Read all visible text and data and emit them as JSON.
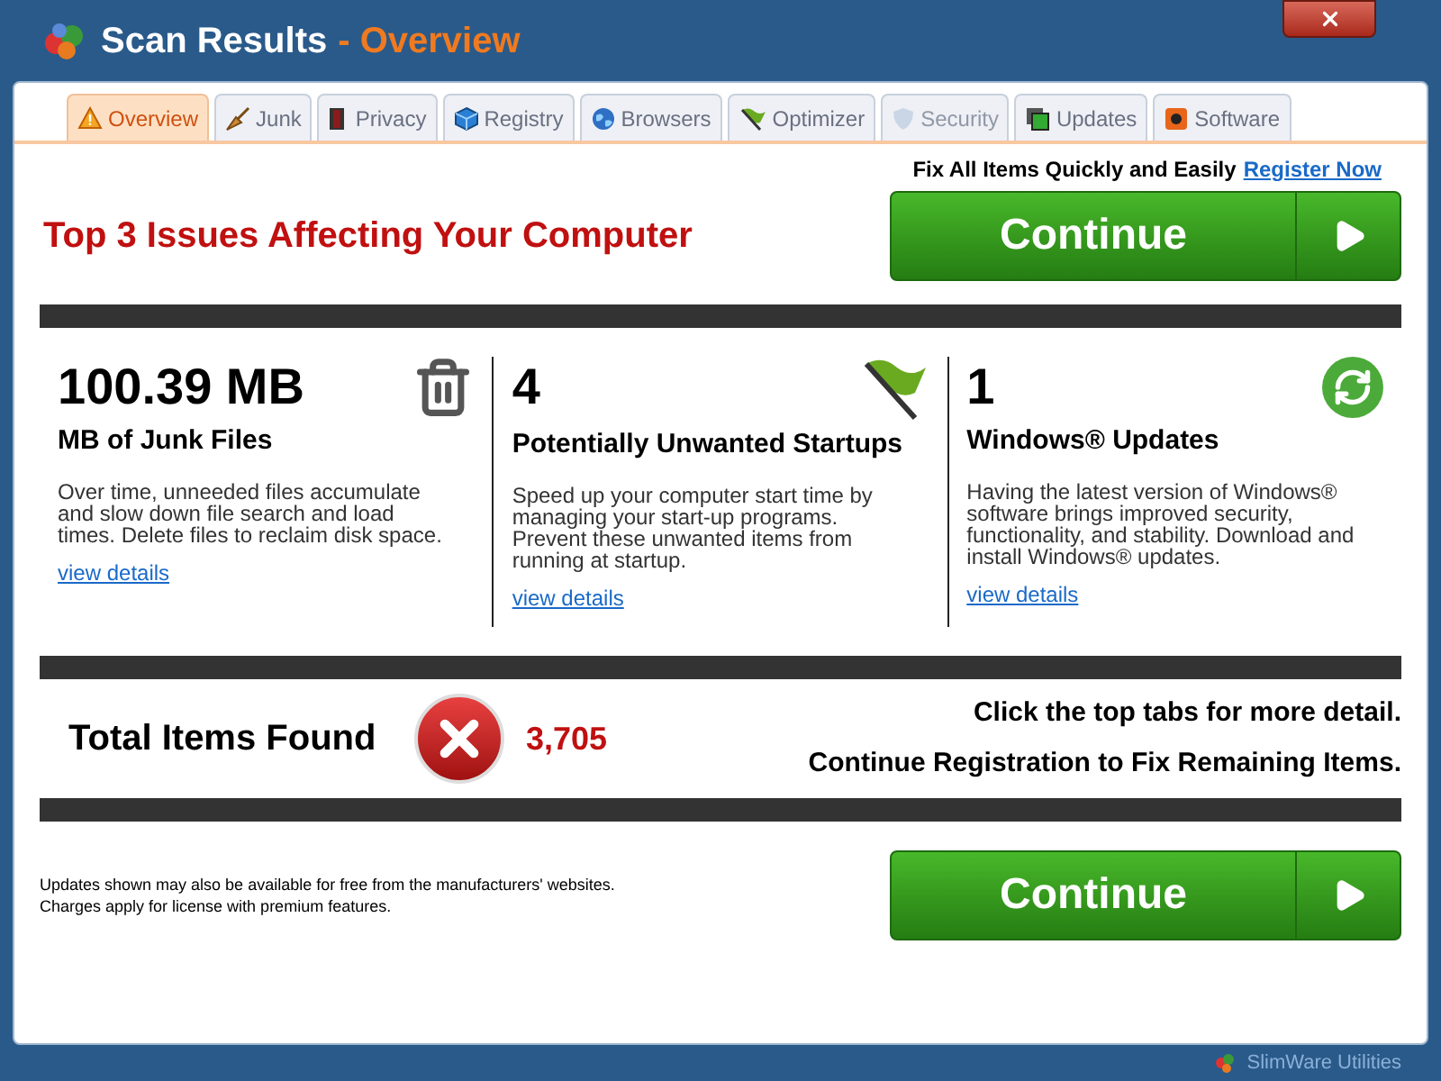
{
  "window": {
    "title": "Scan Results",
    "subtitle": "- Overview"
  },
  "tabs": [
    {
      "label": "Overview",
      "kind": "warning",
      "selected": true,
      "disabled": false
    },
    {
      "label": "Junk",
      "kind": "broom",
      "selected": false,
      "disabled": false
    },
    {
      "label": "Privacy",
      "kind": "door",
      "selected": false,
      "disabled": false
    },
    {
      "label": "Registry",
      "kind": "cube",
      "selected": false,
      "disabled": false
    },
    {
      "label": "Browsers",
      "kind": "globe",
      "selected": false,
      "disabled": false
    },
    {
      "label": "Optimizer",
      "kind": "flag",
      "selected": false,
      "disabled": false
    },
    {
      "label": "Security",
      "kind": "shield",
      "selected": false,
      "disabled": true
    },
    {
      "label": "Updates",
      "kind": "windows",
      "selected": false,
      "disabled": false
    },
    {
      "label": "Software",
      "kind": "box",
      "selected": false,
      "disabled": false
    }
  ],
  "promo": {
    "text": "Fix All Items Quickly and Easily",
    "link": "Register Now"
  },
  "headline": "Top 3 Issues Affecting Your Computer",
  "continue_top": "Continue",
  "issues": [
    {
      "kind": "trash",
      "value": "100.39 MB",
      "title": "MB of Junk Files",
      "description": "Over time, unneeded files accumulate and slow down file search and load times. Delete files to reclaim disk space.",
      "link": "view details"
    },
    {
      "kind": "flag",
      "value": "4",
      "title": "Potentially Unwanted Startups",
      "description": "Speed up your computer start time by managing your start-up programs. Prevent these unwanted items from running at startup.",
      "link": "view details"
    },
    {
      "kind": "refresh",
      "value": "1",
      "title": "Windows® Updates",
      "description": "Having the latest version of Windows® software brings improved security, functionality, and stability. Download and install Windows® updates.",
      "link": "view details"
    }
  ],
  "total": {
    "label": "Total Items Found",
    "count": "3,705"
  },
  "hints": [
    "Click the top tabs for more detail.",
    "Continue Registration to Fix Remaining Items."
  ],
  "disclaimer": [
    "Updates shown may also be available for free from the manufacturers' websites.",
    "Charges apply for license with premium features."
  ],
  "continue_bottom": "Continue",
  "footer": "SlimWare Utilities"
}
